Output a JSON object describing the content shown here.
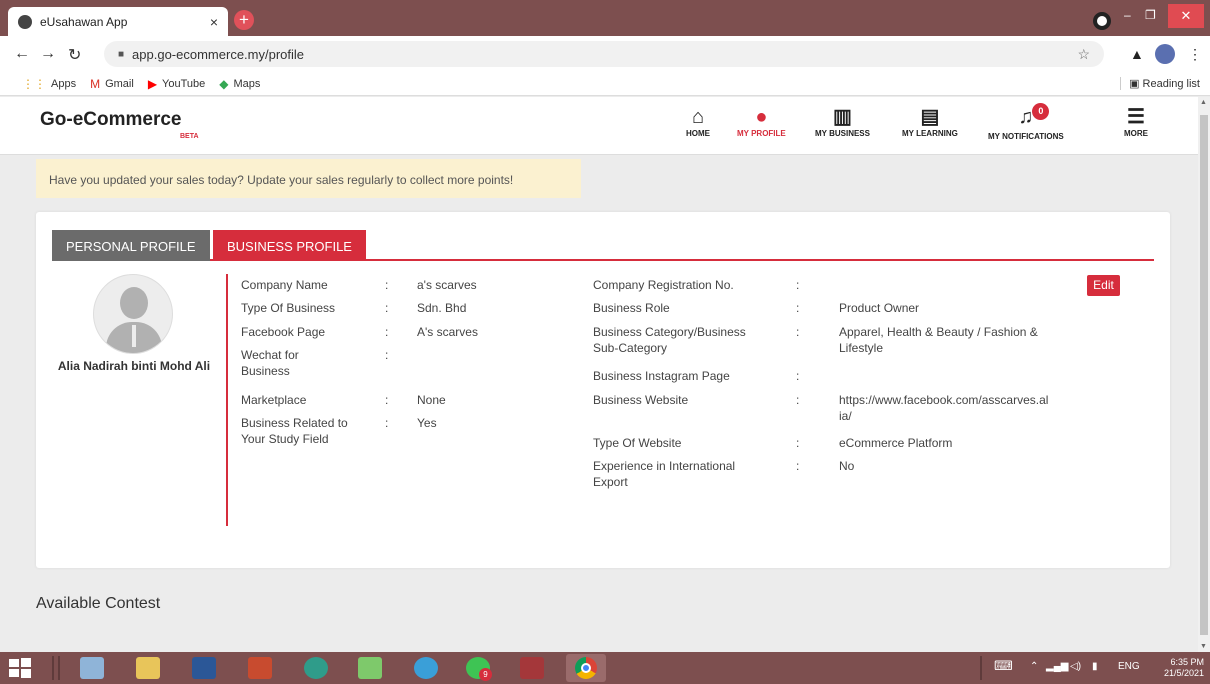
{
  "browser": {
    "tab_title": "eUsahawan App",
    "tab_close": "×",
    "newtab": "+",
    "url": "app.go-ecommerce.my/profile",
    "bookmarks": [
      {
        "icon": "apps-icon",
        "glyph": "⋮⋮",
        "label": "Apps",
        "color": "#e0a420"
      },
      {
        "icon": "gmail-icon",
        "glyph": "M",
        "label": "Gmail",
        "color": "#d93025"
      },
      {
        "icon": "youtube-icon",
        "glyph": "▶",
        "label": "YouTube",
        "color": "#ff0000"
      },
      {
        "icon": "maps-icon",
        "glyph": "◆",
        "label": "Maps",
        "color": "#34a853"
      }
    ],
    "reading_list": "Reading list"
  },
  "site": {
    "logo": "Go-eCommerce",
    "beta": "BETA",
    "nav": [
      {
        "id": "home",
        "icon": "home-icon",
        "glyph": "⌂",
        "label": "HOME"
      },
      {
        "id": "profile",
        "icon": "profile-icon",
        "glyph": "●",
        "label": "MY PROFILE"
      },
      {
        "id": "business",
        "icon": "chart-icon",
        "glyph": "▥",
        "label": "MY BUSINESS"
      },
      {
        "id": "learning",
        "icon": "book-icon",
        "glyph": "▤",
        "label": "MY LEARNING"
      },
      {
        "id": "notifications",
        "icon": "bell-icon",
        "glyph": "♫",
        "label": "MY NOTIFICATIONS",
        "badge": "0"
      },
      {
        "id": "more",
        "icon": "menu-icon",
        "glyph": "☰",
        "label": "MORE"
      }
    ]
  },
  "notice": "Have you updated your sales today? Update your sales regularly to collect more points!",
  "profile": {
    "tabs": {
      "personal": "PERSONAL PROFILE",
      "business": "BUSINESS PROFILE"
    },
    "user_name": "Alia Nadirah binti Mohd Ali",
    "edit": "Edit",
    "colon": ":",
    "left_fields": [
      {
        "label": "Company Name",
        "value": "a's scarves"
      },
      {
        "label": "Type Of Business",
        "value": "Sdn. Bhd"
      },
      {
        "label": "Facebook Page",
        "value": "A's scarves"
      },
      {
        "label": "Wechat for Business",
        "value": ""
      },
      {
        "label": "Marketplace",
        "value": "None"
      },
      {
        "label": "Business Related to Your Study Field",
        "value": "Yes"
      }
    ],
    "right_fields": [
      {
        "label": "Company Registration No.",
        "value": ""
      },
      {
        "label": "Business Role",
        "value": "Product Owner"
      },
      {
        "label": "Business Category/Business Sub-Category",
        "value": "Apparel, Health & Beauty / Fashion & Lifestyle"
      },
      {
        "label": "Business Instagram Page",
        "value": ""
      },
      {
        "label": "Business Website",
        "value": "https://www.facebook.com/asscarves.alia/"
      },
      {
        "label": "Type Of Website",
        "value": "eCommerce Platform"
      },
      {
        "label": "Experience in International Export",
        "value": "No"
      }
    ]
  },
  "contest_title": "Available Contest",
  "taskbar": {
    "tray_lang": "ENG",
    "time": "6:35 PM",
    "date": "21/5/2021",
    "whatsapp_badge": "9"
  },
  "colors": {
    "accent": "#d62d3c",
    "chrome": "#7d4f4f",
    "notice_bg": "#fbf1d0"
  }
}
